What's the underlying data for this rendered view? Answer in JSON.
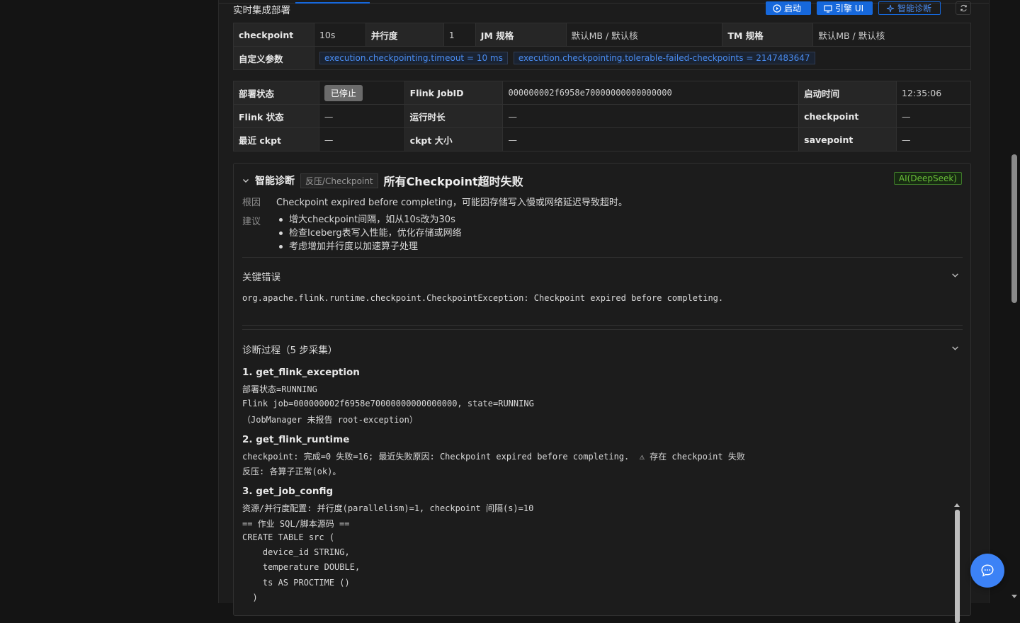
{
  "header": {
    "title": "实时集成部署",
    "buttons": {
      "start": "启动",
      "engine_ui": "引擎 UI",
      "diagnose": "智能诊断"
    }
  },
  "config_table": {
    "rows": [
      [
        {
          "k": "checkpoint",
          "v": "10s"
        },
        {
          "k": "并行度",
          "v": "1"
        },
        {
          "k": "JM 规格",
          "v": "默认MB / 默认核"
        },
        {
          "k": "TM 规格",
          "v": "默认MB / 默认核"
        }
      ]
    ],
    "custom_label": "自定义参数",
    "custom_params": [
      "execution.checkpointing.timeout = 10 ms",
      "execution.checkpointing.tolerable-failed-checkpoints = 2147483647"
    ]
  },
  "status_table": {
    "deploy_state_label": "部署状态",
    "deploy_state_value": "已停止",
    "flink_jobid_label": "Flink JobID",
    "flink_jobid_value": "000000002f6958e70000000000000000",
    "start_time_label": "启动时间",
    "start_time_value": "12:35:06",
    "flink_state_label": "Flink 状态",
    "flink_state_value": "—",
    "runtime_label": "运行时长",
    "runtime_value": "—",
    "checkpoint_label": "checkpoint",
    "checkpoint_value": "—",
    "last_ckpt_label": "最近 ckpt",
    "last_ckpt_value": "—",
    "ckpt_size_label": "ckpt 大小",
    "ckpt_size_value": "—",
    "savepoint_label": "savepoint",
    "savepoint_value": "—"
  },
  "diagnosis": {
    "title": "智能诊断",
    "category": "反压/Checkpoint",
    "headline": "所有Checkpoint超时失败",
    "ai_badge": "AI(DeepSeek)",
    "root_cause_label": "根因",
    "root_cause": "Checkpoint expired before completing，可能因存储写入慢或网络延迟导致超时。",
    "suggestion_label": "建议",
    "suggestions": [
      "增大checkpoint间隔，如从10s改为30s",
      "检查Iceberg表写入性能，优化存储或网络",
      "考虑增加并行度以加速算子处理"
    ],
    "key_error_label": "关键错误",
    "key_error": "org.apache.flink.runtime.checkpoint.CheckpointException: Checkpoint expired before completing.",
    "process_label": "诊断过程（5 步采集）",
    "steps": [
      {
        "title": "1. get_flink_exception",
        "lines": [
          "部署状态=RUNNING",
          "Flink job=000000002f6958e70000000000000000, state=RUNNING",
          "（JobManager 未报告 root-exception）"
        ]
      },
      {
        "title": "2. get_flink_runtime",
        "lines": [
          "checkpoint: 完成=0 失败=16; 最近失败原因: Checkpoint expired before completing.  ⚠ 存在 checkpoint 失败",
          "反压: 各算子正常(ok)。"
        ]
      },
      {
        "title": "3. get_job_config",
        "lines": [
          "资源/并行度配置: 并行度(parallelism)=1, checkpoint 间隔(s)=10",
          "== 作业 SQL/脚本源码 ==",
          "CREATE TABLE src (",
          "    device_id STRING,",
          "    temperature DOUBLE,",
          "    ts AS PROCTIME ()",
          "  )"
        ]
      }
    ]
  },
  "colors": {
    "accent": "#1668dc",
    "success": "#6abe39",
    "stopped": "#6b6b6b"
  }
}
